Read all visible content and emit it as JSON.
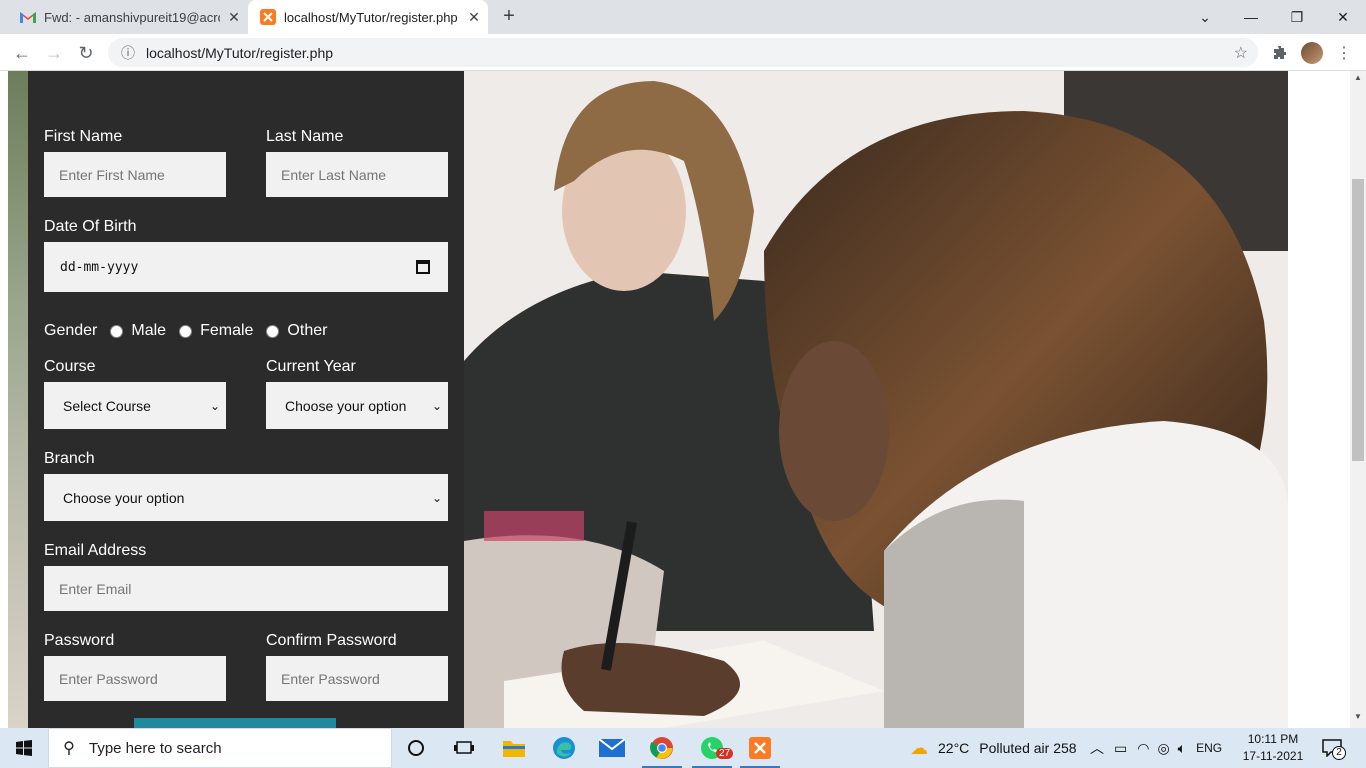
{
  "browser": {
    "tabs": [
      {
        "title": "Fwd: - amanshivpureit19@acropo",
        "favicon": "gmail-icon",
        "active": false
      },
      {
        "title": "localhost/MyTutor/register.php",
        "favicon": "xampp-icon",
        "active": true
      }
    ],
    "address": "localhost/MyTutor/register.php",
    "window_controls": [
      "minimize-icon",
      "restore-icon",
      "close-icon"
    ]
  },
  "form": {
    "first_name": {
      "label": "First Name",
      "placeholder": "Enter First Name"
    },
    "last_name": {
      "label": "Last Name",
      "placeholder": "Enter Last Name"
    },
    "dob": {
      "label": "Date Of Birth",
      "placeholder": "dd-mm-yyyy"
    },
    "gender": {
      "label": "Gender",
      "options": [
        "Male",
        "Female",
        "Other"
      ]
    },
    "course": {
      "label": "Course",
      "selected": "Select Course"
    },
    "current_year": {
      "label": "Current Year",
      "selected": "Choose your option"
    },
    "branch": {
      "label": "Branch",
      "selected": "Choose your option"
    },
    "email": {
      "label": "Email Address",
      "placeholder": "Enter Email"
    },
    "password": {
      "label": "Password",
      "placeholder": "Enter Password"
    },
    "confirm_password": {
      "label": "Confirm Password",
      "placeholder": "Enter Password"
    }
  },
  "colors": {
    "form_panel": "#2b2b2b",
    "submit_button": "#1f8a9e",
    "input_bg": "#f1f1f1"
  },
  "taskbar": {
    "search_placeholder": "Type here to search",
    "weather": "22°C",
    "air_quality": "Polluted air 258",
    "language": "ENG",
    "time": "10:11 PM",
    "date": "17-11-2021",
    "whatsapp_badge": "27",
    "notification_count": "2"
  }
}
